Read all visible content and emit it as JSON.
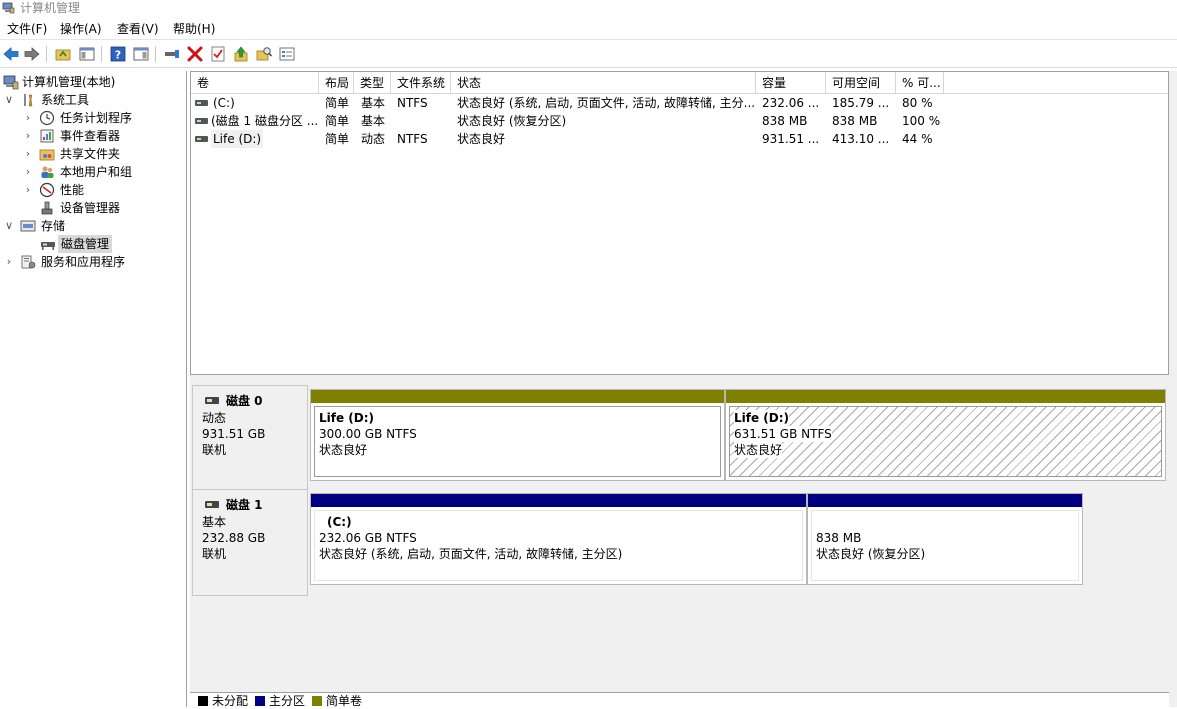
{
  "window": {
    "title": "计算机管理"
  },
  "menu": [
    "文件(F)",
    "操作(A)",
    "查看(V)",
    "帮助(H)"
  ],
  "tree": {
    "root": "计算机管理(本地)",
    "system_tools": "系统工具",
    "task_scheduler": "任务计划程序",
    "event_viewer": "事件查看器",
    "shared_folders": "共享文件夹",
    "local_users": "本地用户和组",
    "performance": "性能",
    "device_manager": "设备管理器",
    "storage": "存储",
    "disk_management": "磁盘管理",
    "services_apps": "服务和应用程序"
  },
  "volume_table": {
    "columns": [
      "卷",
      "布局",
      "类型",
      "文件系统",
      "状态",
      "容量",
      "可用空间",
      "% 可..."
    ],
    "rows": [
      {
        "volume": "(C:)",
        "layout": "简单",
        "type": "基本",
        "fs": "NTFS",
        "status": "状态良好 (系统, 启动, 页面文件, 活动, 故障转储, 主分...",
        "capacity": "232.06 ...",
        "free": "185.79 ...",
        "pct": "80 %"
      },
      {
        "volume": "(磁盘 1 磁盘分区 ...",
        "layout": "简单",
        "type": "基本",
        "fs": "",
        "status": "状态良好 (恢复分区)",
        "capacity": "838 MB",
        "free": "838 MB",
        "pct": "100 %"
      },
      {
        "volume": "Life (D:)",
        "layout": "简单",
        "type": "动态",
        "fs": "NTFS",
        "status": "状态良好",
        "capacity": "931.51 ...",
        "free": "413.10 ...",
        "pct": "44 %"
      }
    ]
  },
  "disks": [
    {
      "name": "磁盘 0",
      "kind": "动态",
      "size": "931.51 GB",
      "state": "联机",
      "partitions": [
        {
          "title": "Life  (D:)",
          "size": "300.00 GB NTFS",
          "status": "状态良好"
        },
        {
          "title": "Life  (D:)",
          "size": "631.51 GB NTFS",
          "status": "状态良好"
        }
      ]
    },
    {
      "name": "磁盘 1",
      "kind": "基本",
      "size": "232.88 GB",
      "state": "联机",
      "partitions": [
        {
          "title": "(C:)",
          "size": "232.06 GB NTFS",
          "status": "状态良好 (系统, 启动, 页面文件, 活动, 故障转储, 主分区)"
        },
        {
          "title": "",
          "size": "838 MB",
          "status": "状态良好 (恢复分区)"
        }
      ]
    }
  ],
  "legend": [
    "未分配",
    "主分区",
    "简单卷"
  ],
  "colors": {
    "unallocated": "#000000",
    "primary": "#000080",
    "simple": "#808000"
  }
}
